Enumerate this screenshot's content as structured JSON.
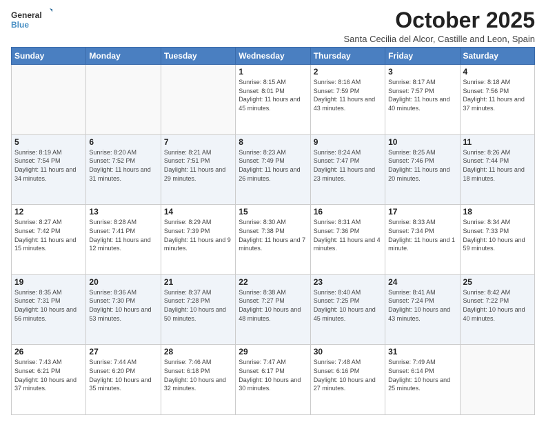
{
  "logo": {
    "line1": "General",
    "line2": "Blue"
  },
  "title": "October 2025",
  "subtitle": "Santa Cecilia del Alcor, Castille and Leon, Spain",
  "days_of_week": [
    "Sunday",
    "Monday",
    "Tuesday",
    "Wednesday",
    "Thursday",
    "Friday",
    "Saturday"
  ],
  "weeks": [
    [
      {
        "day": "",
        "info": ""
      },
      {
        "day": "",
        "info": ""
      },
      {
        "day": "",
        "info": ""
      },
      {
        "day": "1",
        "info": "Sunrise: 8:15 AM\nSunset: 8:01 PM\nDaylight: 11 hours and 45 minutes."
      },
      {
        "day": "2",
        "info": "Sunrise: 8:16 AM\nSunset: 7:59 PM\nDaylight: 11 hours and 43 minutes."
      },
      {
        "day": "3",
        "info": "Sunrise: 8:17 AM\nSunset: 7:57 PM\nDaylight: 11 hours and 40 minutes."
      },
      {
        "day": "4",
        "info": "Sunrise: 8:18 AM\nSunset: 7:56 PM\nDaylight: 11 hours and 37 minutes."
      }
    ],
    [
      {
        "day": "5",
        "info": "Sunrise: 8:19 AM\nSunset: 7:54 PM\nDaylight: 11 hours and 34 minutes."
      },
      {
        "day": "6",
        "info": "Sunrise: 8:20 AM\nSunset: 7:52 PM\nDaylight: 11 hours and 31 minutes."
      },
      {
        "day": "7",
        "info": "Sunrise: 8:21 AM\nSunset: 7:51 PM\nDaylight: 11 hours and 29 minutes."
      },
      {
        "day": "8",
        "info": "Sunrise: 8:23 AM\nSunset: 7:49 PM\nDaylight: 11 hours and 26 minutes."
      },
      {
        "day": "9",
        "info": "Sunrise: 8:24 AM\nSunset: 7:47 PM\nDaylight: 11 hours and 23 minutes."
      },
      {
        "day": "10",
        "info": "Sunrise: 8:25 AM\nSunset: 7:46 PM\nDaylight: 11 hours and 20 minutes."
      },
      {
        "day": "11",
        "info": "Sunrise: 8:26 AM\nSunset: 7:44 PM\nDaylight: 11 hours and 18 minutes."
      }
    ],
    [
      {
        "day": "12",
        "info": "Sunrise: 8:27 AM\nSunset: 7:42 PM\nDaylight: 11 hours and 15 minutes."
      },
      {
        "day": "13",
        "info": "Sunrise: 8:28 AM\nSunset: 7:41 PM\nDaylight: 11 hours and 12 minutes."
      },
      {
        "day": "14",
        "info": "Sunrise: 8:29 AM\nSunset: 7:39 PM\nDaylight: 11 hours and 9 minutes."
      },
      {
        "day": "15",
        "info": "Sunrise: 8:30 AM\nSunset: 7:38 PM\nDaylight: 11 hours and 7 minutes."
      },
      {
        "day": "16",
        "info": "Sunrise: 8:31 AM\nSunset: 7:36 PM\nDaylight: 11 hours and 4 minutes."
      },
      {
        "day": "17",
        "info": "Sunrise: 8:33 AM\nSunset: 7:34 PM\nDaylight: 11 hours and 1 minute."
      },
      {
        "day": "18",
        "info": "Sunrise: 8:34 AM\nSunset: 7:33 PM\nDaylight: 10 hours and 59 minutes."
      }
    ],
    [
      {
        "day": "19",
        "info": "Sunrise: 8:35 AM\nSunset: 7:31 PM\nDaylight: 10 hours and 56 minutes."
      },
      {
        "day": "20",
        "info": "Sunrise: 8:36 AM\nSunset: 7:30 PM\nDaylight: 10 hours and 53 minutes."
      },
      {
        "day": "21",
        "info": "Sunrise: 8:37 AM\nSunset: 7:28 PM\nDaylight: 10 hours and 50 minutes."
      },
      {
        "day": "22",
        "info": "Sunrise: 8:38 AM\nSunset: 7:27 PM\nDaylight: 10 hours and 48 minutes."
      },
      {
        "day": "23",
        "info": "Sunrise: 8:40 AM\nSunset: 7:25 PM\nDaylight: 10 hours and 45 minutes."
      },
      {
        "day": "24",
        "info": "Sunrise: 8:41 AM\nSunset: 7:24 PM\nDaylight: 10 hours and 43 minutes."
      },
      {
        "day": "25",
        "info": "Sunrise: 8:42 AM\nSunset: 7:22 PM\nDaylight: 10 hours and 40 minutes."
      }
    ],
    [
      {
        "day": "26",
        "info": "Sunrise: 7:43 AM\nSunset: 6:21 PM\nDaylight: 10 hours and 37 minutes."
      },
      {
        "day": "27",
        "info": "Sunrise: 7:44 AM\nSunset: 6:20 PM\nDaylight: 10 hours and 35 minutes."
      },
      {
        "day": "28",
        "info": "Sunrise: 7:46 AM\nSunset: 6:18 PM\nDaylight: 10 hours and 32 minutes."
      },
      {
        "day": "29",
        "info": "Sunrise: 7:47 AM\nSunset: 6:17 PM\nDaylight: 10 hours and 30 minutes."
      },
      {
        "day": "30",
        "info": "Sunrise: 7:48 AM\nSunset: 6:16 PM\nDaylight: 10 hours and 27 minutes."
      },
      {
        "day": "31",
        "info": "Sunrise: 7:49 AM\nSunset: 6:14 PM\nDaylight: 10 hours and 25 minutes."
      },
      {
        "day": "",
        "info": ""
      }
    ]
  ]
}
